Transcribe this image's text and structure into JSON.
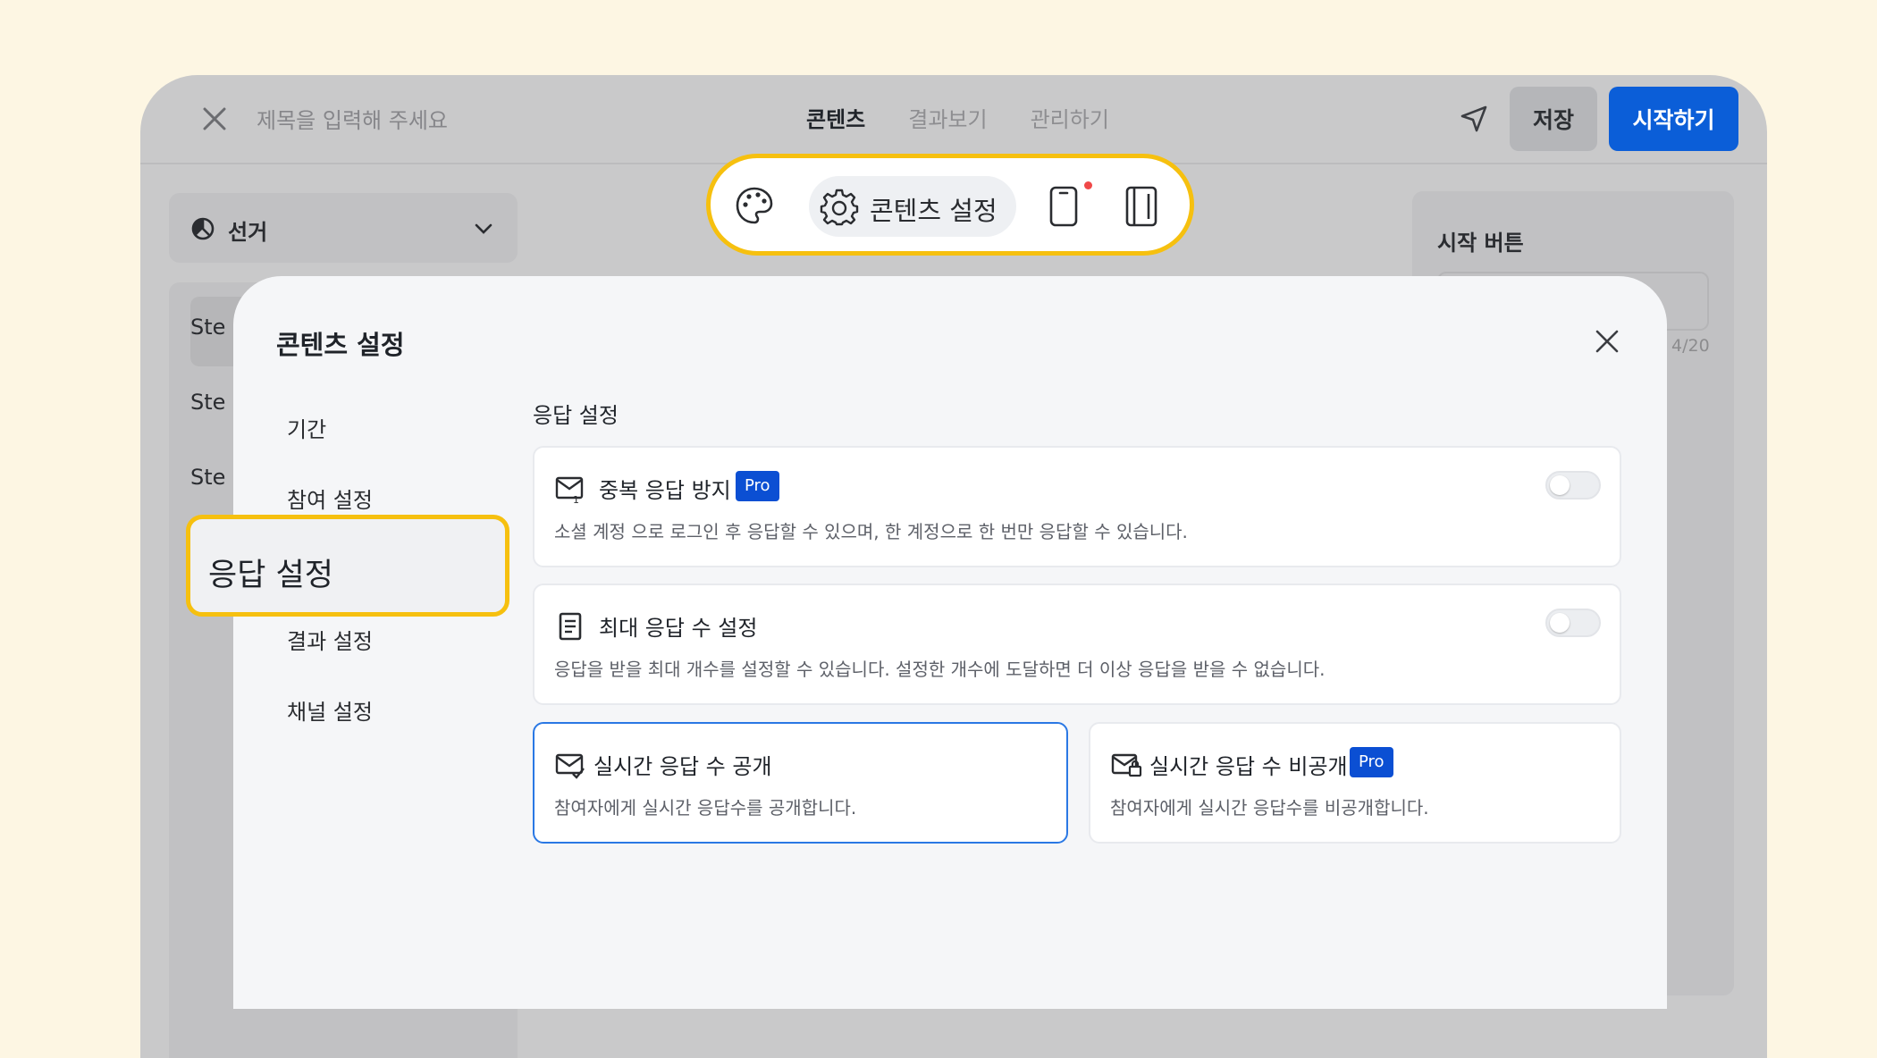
{
  "topbar": {
    "title_placeholder": "제목을 입력해 주세요",
    "tabs": [
      {
        "label": "콘텐츠",
        "active": true
      },
      {
        "label": "결과보기",
        "active": false
      },
      {
        "label": "관리하기",
        "active": false
      }
    ],
    "save_label": "저장",
    "start_label": "시작하기"
  },
  "left_panel": {
    "dropdown_label": "선거",
    "steps": [
      "Ste",
      "Ste",
      "Ste"
    ]
  },
  "right_panel": {
    "start_button_label": "시작 버튼",
    "counter": "4/20"
  },
  "floating_toolbar": {
    "settings_label": "콘텐츠 설정"
  },
  "modal": {
    "title": "콘텐츠 설정",
    "menu": [
      "기간",
      "참여 설정",
      "응답 설정",
      "결과 설정",
      "채널 설정"
    ],
    "active_menu": "응답 설정",
    "section_title": "응답 설정",
    "cards": [
      {
        "title": "중복 응답 방지",
        "badge": "Pro",
        "desc": "소셜 계정 으로 로그인 후 응답할 수 있으며, 한 계정으로 한 번만 응답할 수 있습니다.",
        "toggle": false
      },
      {
        "title": "최대 응답 수 설정",
        "desc": "응답을 받을 최대 개수를 설정할 수 있습니다. 설정한 개수에 도달하면 더 이상 응답을 받을 수 없습니다.",
        "toggle": false
      },
      {
        "title": "실시간 응답 수 공개",
        "desc": "참여자에게 실시간 응답수를 공개합니다.",
        "selected": true
      },
      {
        "title": "실시간 응답 수 비공개",
        "badge": "Pro",
        "desc": "참여자에게 실시간 응답수를 비공개합니다.",
        "selected": false
      }
    ]
  },
  "colors": {
    "accent": "#0b5ed8",
    "highlight": "#f6c00f",
    "pro_badge": "#0b4fd3"
  }
}
